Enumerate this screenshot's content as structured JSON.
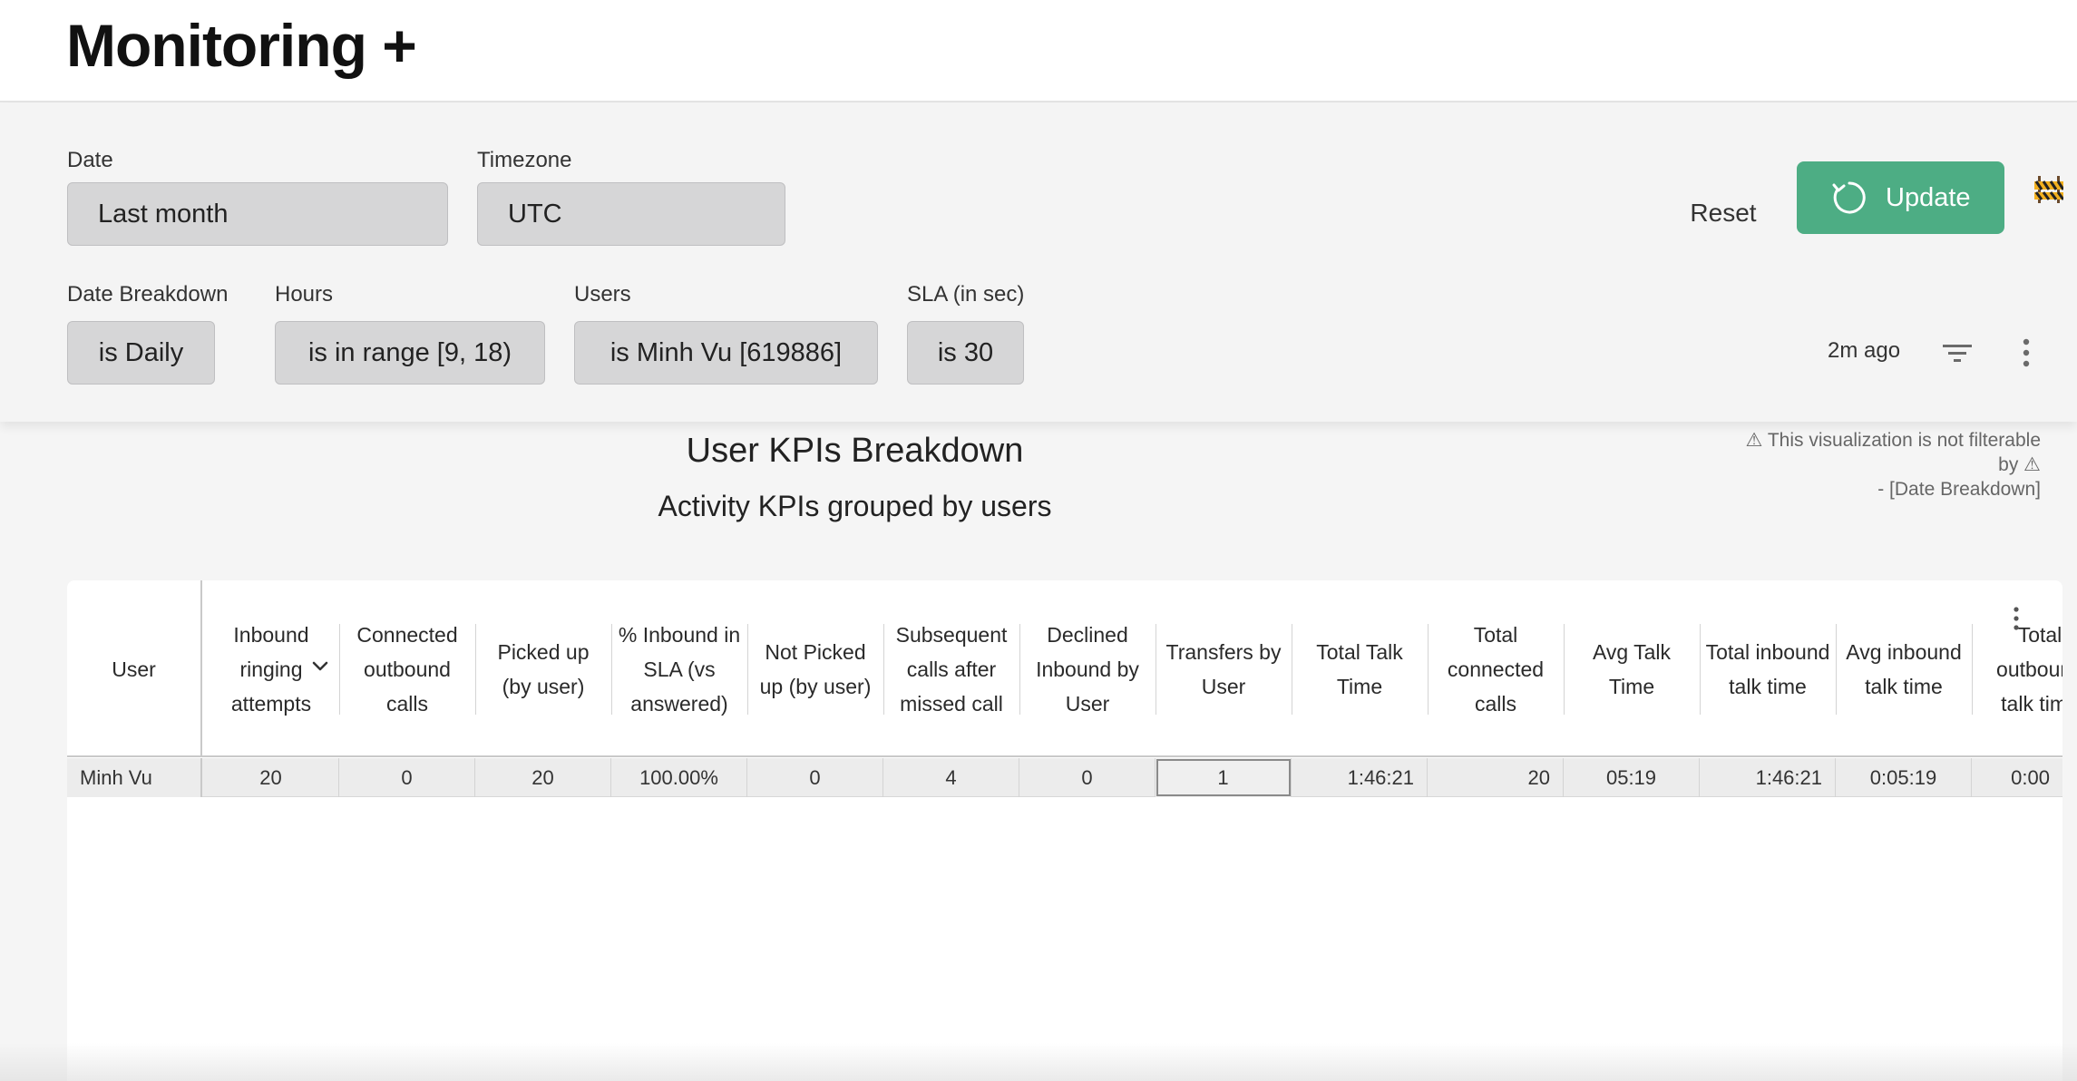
{
  "app": {
    "title": "Monitoring +"
  },
  "filters": {
    "date": {
      "label": "Date",
      "value": "Last month"
    },
    "timezone": {
      "label": "Timezone",
      "value": "UTC"
    },
    "date_breakdown": {
      "label": "Date Breakdown",
      "value": "is Daily"
    },
    "hours": {
      "label": "Hours",
      "value": "is in range [9, 18)"
    },
    "users": {
      "label": "Users",
      "value": "is Minh Vu [619886]"
    },
    "sla": {
      "label": "SLA (in sec)",
      "value": "is 30"
    }
  },
  "actions": {
    "reset_label": "Reset",
    "update_label": "Update",
    "last_updated": "2m ago",
    "accent_color": "#4dad84"
  },
  "visualization": {
    "title": "User KPIs Breakdown",
    "subtitle": "Activity KPIs grouped by users",
    "warning_line1": "⚠ This visualization is not filterable",
    "warning_line2": "by ⚠",
    "warning_line3": "- [Date Breakdown]"
  },
  "table": {
    "columns": [
      "User",
      "Inbound ringing attempts",
      "Connected outbound calls",
      "Picked up (by user)",
      "% Inbound in SLA (vs answered)",
      "Not Picked up (by user)",
      "Subsequent calls after missed call",
      "Declined Inbound by User",
      "Transfers by User",
      "Total Talk Time",
      "Total connected calls",
      "Avg Talk Time",
      "Total inbound talk time",
      "Avg inbound talk time",
      "Total outbound talk time"
    ],
    "rows": [
      [
        "Minh Vu",
        "20",
        "0",
        "20",
        "100.00%",
        "0",
        "4",
        "0",
        "1",
        "1:46:21",
        "20",
        "05:19",
        "1:46:21",
        "0:05:19",
        "0:00"
      ]
    ]
  }
}
